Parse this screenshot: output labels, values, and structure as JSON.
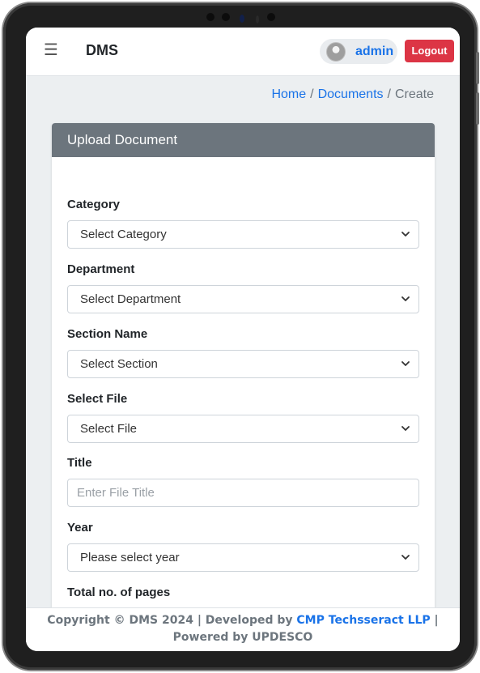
{
  "navbar": {
    "brand": "DMS",
    "user": "admin",
    "logout_label": "Logout"
  },
  "breadcrumb": {
    "home": "Home",
    "documents": "Documents",
    "current": "Create",
    "separator": "/"
  },
  "card": {
    "title": "Upload Document"
  },
  "form": {
    "category": {
      "label": "Category",
      "value": "Select Category"
    },
    "department": {
      "label": "Department",
      "value": "Select Department"
    },
    "section": {
      "label": "Section Name",
      "value": "Select Section"
    },
    "file": {
      "label": "Select File",
      "value": "Select File"
    },
    "title": {
      "label": "Title",
      "placeholder": "Enter File Title"
    },
    "year": {
      "label": "Year",
      "value": "Please select year"
    },
    "pages": {
      "label": "Total no. of pages"
    }
  },
  "footer": {
    "prefix": "Copyright © DMS 2024 | Developed by ",
    "company": "CMP Techsseract LLP",
    "suffix": " | Powered by UPDESCO"
  },
  "colors": {
    "primary": "#1a73e8",
    "danger": "#dc3545",
    "card_header": "#6c757d"
  }
}
